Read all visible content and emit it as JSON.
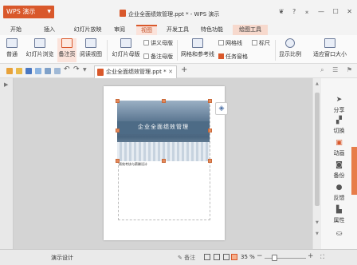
{
  "app": {
    "name": "WPS 演示",
    "document_title": "企业全面绩效管理.ppt * - WPS 演示"
  },
  "window_controls": {
    "skin": "❦",
    "help": "?",
    "collapse": "⌅",
    "minimize": "—",
    "maximize": "☐",
    "close": "✕"
  },
  "tabs": [
    {
      "label": "开始"
    },
    {
      "label": "插入"
    },
    {
      "label": "幻灯片放映"
    },
    {
      "label": "审阅"
    },
    {
      "label": "视图",
      "active": true
    },
    {
      "label": "开发工具"
    },
    {
      "label": "特色功能"
    },
    {
      "label": "绘图工具",
      "tool": true
    }
  ],
  "ribbon": {
    "normal": "普通",
    "slide_browse": "幻灯片浏览",
    "notes_page": "备注页",
    "reading_view": "阅读视图",
    "slide_master": "幻灯片母版",
    "handout_master": "讲义母版",
    "notes_master": "备注母版",
    "grid_guides": "网格和参考线",
    "gridlines": "网格线",
    "ruler": "标尺",
    "task_pane": "任务窗格",
    "display_ratio": "显示比例",
    "fit_window": "适应窗口大小"
  },
  "doc_tab": {
    "label": "企业全面绩效管理.ppt *"
  },
  "slide": {
    "title": "企业全面绩效管理",
    "subtitle": "绩效考核与薪酬设计"
  },
  "sidebar": [
    {
      "label": "分享",
      "icon": "share-icon"
    },
    {
      "label": "切换",
      "icon": "switch-icon"
    },
    {
      "label": "动画",
      "icon": "animation-icon"
    },
    {
      "label": "备份",
      "icon": "backup-icon"
    },
    {
      "label": "反馈",
      "icon": "feedback-icon"
    },
    {
      "label": "属性",
      "icon": "properties-icon"
    }
  ],
  "status": {
    "design": "演示设计",
    "notes": "备注",
    "zoom": "35 %"
  }
}
